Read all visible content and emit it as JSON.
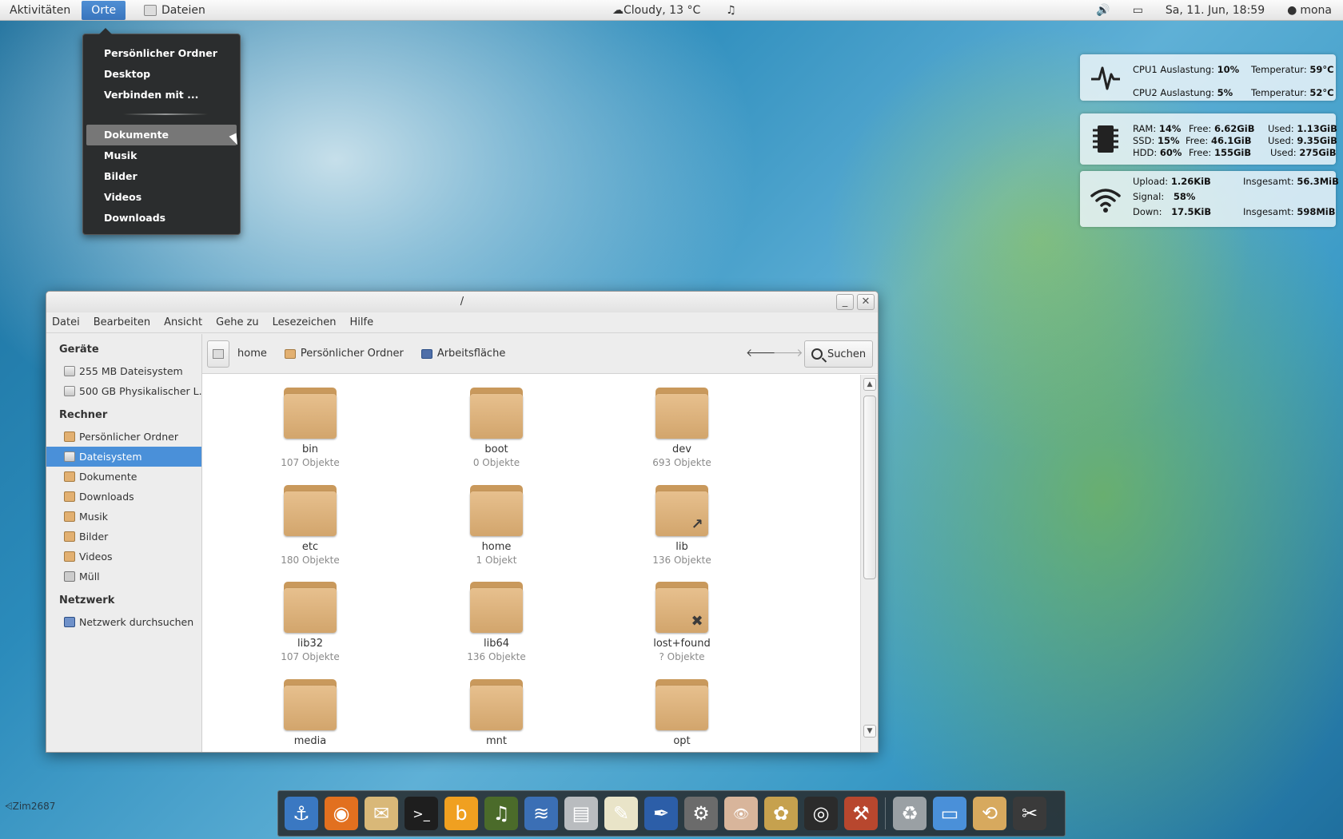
{
  "topbar": {
    "activities": "Aktivitäten",
    "places": "Orte",
    "files_app": "Dateien",
    "weather": "☁Cloudy, 13 °C",
    "music_icon": "♫",
    "volume_icon": "🔊",
    "battery_icon": "▭",
    "datetime": "Sa, 11. Jun, 18:59",
    "user": "mona",
    "user_icon": "●"
  },
  "places_menu": {
    "items_top": [
      "Persönlicher Ordner",
      "Desktop",
      "Verbinden mit ..."
    ],
    "active": "Dokumente",
    "items_bottom": [
      "Musik",
      "Bilder",
      "Videos",
      "Downloads"
    ]
  },
  "conky": {
    "cpu": {
      "cpu1_label": "CPU1",
      "cpu1_load_label": "Auslastung:",
      "cpu1_load": "10%",
      "cpu1_temp_label": "Temperatur:",
      "cpu1_temp": "59°C",
      "cpu2_label": "CPU2",
      "cpu2_load_label": "Auslastung:",
      "cpu2_load": "5%",
      "cpu2_temp_label": "Temperatur:",
      "cpu2_temp": "52°C"
    },
    "mem": {
      "ram_label": "RAM:",
      "ram_pct": "14%",
      "ram_free_label": "Free:",
      "ram_free": "6.62GiB",
      "ram_used_label": "Used:",
      "ram_used": "1.13GiB",
      "ssd_label": "SSD:",
      "ssd_pct": "15%",
      "ssd_free_label": "Free:",
      "ssd_free": "46.1GiB",
      "ssd_used_label": "Used:",
      "ssd_used": "9.35GiB",
      "hdd_label": "HDD:",
      "hdd_pct": "60%",
      "hdd_free_label": "Free:",
      "hdd_free": "155GiB",
      "hdd_used_label": "Used:",
      "hdd_used": "275GiB"
    },
    "net": {
      "upload_label": "Upload:",
      "upload": "1.26KiB",
      "upload_total_label": "Insgesamt:",
      "upload_total": "56.3MiB",
      "signal_label": "Signal:",
      "signal": "58%",
      "down_label": "Down:",
      "down": "17.5KiB",
      "down_total_label": "Insgesamt:",
      "down_total": "598MiB"
    }
  },
  "window": {
    "title": "/",
    "minimize": "_",
    "close": "✕",
    "menu": [
      "Datei",
      "Bearbeiten",
      "Ansicht",
      "Gehe zu",
      "Lesezeichen",
      "Hilfe"
    ],
    "sidebar": {
      "devices_heading": "Geräte",
      "devices": [
        "255 MB Dateisystem",
        "500 GB Physikalischer L..."
      ],
      "computer_heading": "Rechner",
      "computer": [
        "Persönlicher Ordner",
        "Dateisystem",
        "Dokumente",
        "Downloads",
        "Musik",
        "Bilder",
        "Videos",
        "Müll"
      ],
      "network_heading": "Netzwerk",
      "network": [
        "Netzwerk durchsuchen"
      ]
    },
    "pathbar": {
      "crumbs": [
        "home",
        "Persönlicher Ordner",
        "Arbeitsfläche"
      ],
      "back_icon": "🡐",
      "forward_icon": "🡒",
      "search_label": "Suchen"
    },
    "folders": [
      {
        "name": "bin",
        "count": "107 Objekte",
        "emblem": ""
      },
      {
        "name": "boot",
        "count": "0 Objekte",
        "emblem": ""
      },
      {
        "name": "dev",
        "count": "693 Objekte",
        "emblem": ""
      },
      {
        "name": "etc",
        "count": "180 Objekte",
        "emblem": ""
      },
      {
        "name": "home",
        "count": "1 Objekt",
        "emblem": ""
      },
      {
        "name": "lib",
        "count": "136 Objekte",
        "emblem": "↗"
      },
      {
        "name": "lib32",
        "count": "107 Objekte",
        "emblem": ""
      },
      {
        "name": "lib64",
        "count": "136 Objekte",
        "emblem": ""
      },
      {
        "name": "lost+found",
        "count": "? Objekte",
        "emblem": "✖"
      },
      {
        "name": "media",
        "count": "",
        "emblem": ""
      },
      {
        "name": "mnt",
        "count": "",
        "emblem": ""
      },
      {
        "name": "opt",
        "count": "",
        "emblem": ""
      }
    ]
  },
  "dock": {
    "items": [
      {
        "name": "anchor-icon",
        "glyph": "⚓",
        "color": "#3a78c2"
      },
      {
        "name": "firefox-icon",
        "glyph": "◉",
        "color": "#e2701f"
      },
      {
        "name": "mail-icon",
        "glyph": "✉",
        "color": "#d9b878"
      },
      {
        "name": "terminal-icon",
        "glyph": ">_",
        "color": "#1e1e1e"
      },
      {
        "name": "banshee-icon",
        "glyph": "b",
        "color": "#f0a020"
      },
      {
        "name": "music-player-icon",
        "glyph": "♫",
        "color": "#4b6b2a"
      },
      {
        "name": "network-icon",
        "glyph": "≋",
        "color": "#3b6fb5"
      },
      {
        "name": "file-cabinet-icon",
        "glyph": "▤",
        "color": "#b9bcbf"
      },
      {
        "name": "text-editor-icon",
        "glyph": "✎",
        "color": "#e9e4c8"
      },
      {
        "name": "inkscape-icon",
        "glyph": "✒",
        "color": "#2c5ea8"
      },
      {
        "name": "settings-icon",
        "glyph": "⚙",
        "color": "#6b6b6b"
      },
      {
        "name": "eye-icon",
        "glyph": "👁",
        "color": "#d8b59b"
      },
      {
        "name": "paint-icon",
        "glyph": "✿",
        "color": "#c6a14e"
      },
      {
        "name": "camera-icon",
        "glyph": "◎",
        "color": "#2b2b2b"
      },
      {
        "name": "tools-icon",
        "glyph": "⚒",
        "color": "#b8472e"
      },
      {
        "name": "trash-icon",
        "glyph": "♻",
        "color": "#9aa0a4"
      },
      {
        "name": "window-icon",
        "glyph": "▭",
        "color": "#4a90d9"
      },
      {
        "name": "backup-icon",
        "glyph": "⟲",
        "color": "#d7a95e"
      },
      {
        "name": "scissors-icon",
        "glyph": "✂",
        "color": "#3a3a3a"
      }
    ]
  },
  "watermark": "⩤Zim2687"
}
